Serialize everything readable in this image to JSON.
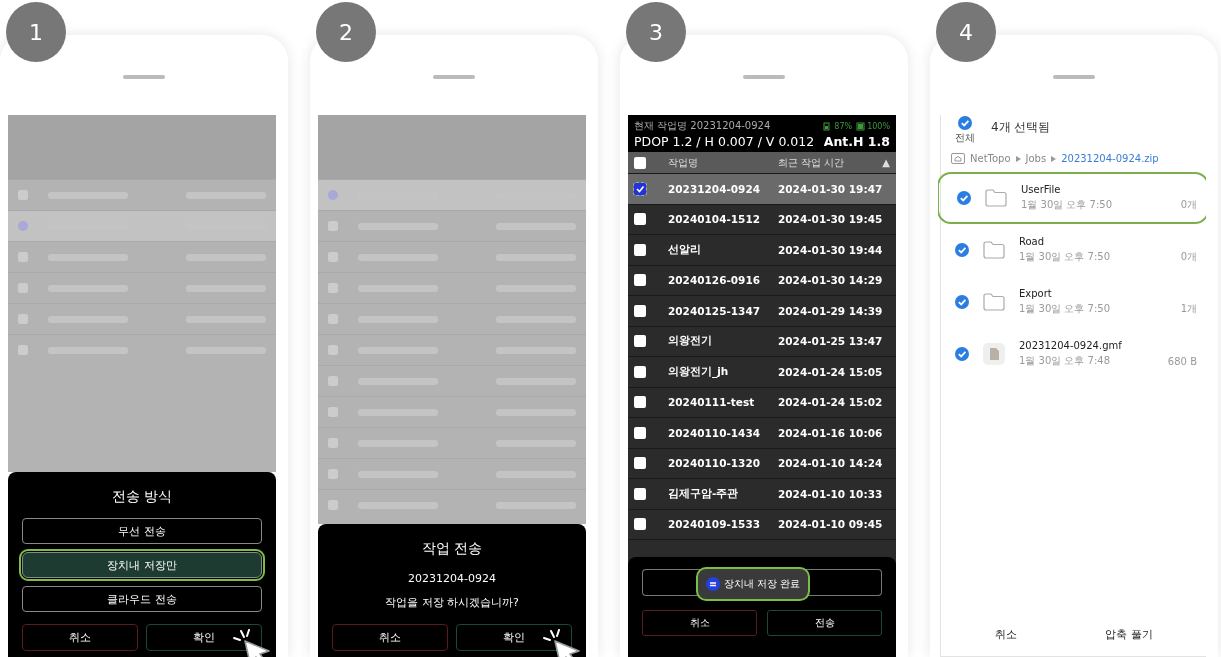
{
  "steps": [
    {
      "number": "1",
      "kind": "method",
      "dimmed_rows": [
        {
          "selected": false
        },
        {
          "selected": true
        },
        {
          "selected": false
        },
        {
          "selected": false
        },
        {
          "selected": false
        },
        {
          "selected": false
        }
      ],
      "dialog": {
        "title": "전송 방식",
        "options": [
          {
            "label": "무선 전송",
            "selected": false,
            "highlighted": false
          },
          {
            "label": "장치내 저장만",
            "selected": true,
            "highlighted": true
          },
          {
            "label": "클라우드 전송",
            "selected": false,
            "highlighted": false
          }
        ],
        "cancel": "취소",
        "confirm": "확인"
      }
    },
    {
      "number": "2",
      "kind": "confirm",
      "dimmed_rows": [
        {
          "selected": true
        },
        {
          "selected": false
        },
        {
          "selected": false
        },
        {
          "selected": false
        },
        {
          "selected": false
        },
        {
          "selected": false
        },
        {
          "selected": false
        },
        {
          "selected": false
        },
        {
          "selected": false
        },
        {
          "selected": false
        },
        {
          "selected": false
        }
      ],
      "dialog": {
        "title": "작업 전송",
        "job": "20231204-0924",
        "question": "작업을 저장 하시겠습니까?",
        "cancel": "취소",
        "confirm": "확인"
      }
    },
    {
      "number": "3",
      "kind": "jobs",
      "header": {
        "job_label": "현재 작업명 20231204-0924",
        "battery_1": "87%",
        "battery_2": "100%",
        "precision": "PDOP 1.2 / H 0.007 / V 0.012",
        "antenna": "Ant.H 1.8"
      },
      "select_all_checked": false,
      "columns": [
        "작업명",
        "최근 작업 시간",
        "▲"
      ],
      "rows": [
        {
          "name": "20231204-0924",
          "time": "2024-01-30 19:47",
          "checked": true
        },
        {
          "name": "20240104-1512",
          "time": "2024-01-30 19:45",
          "checked": false
        },
        {
          "name": "선알리",
          "time": "2024-01-30 19:44",
          "checked": false
        },
        {
          "name": "20240126-0916",
          "time": "2024-01-30 14:29",
          "checked": false
        },
        {
          "name": "20240125-1347",
          "time": "2024-01-29 14:39",
          "checked": false
        },
        {
          "name": "의왕전기",
          "time": "2024-01-25 13:47",
          "checked": false
        },
        {
          "name": "의왕전기_jh",
          "time": "2024-01-24 15:05",
          "checked": false
        },
        {
          "name": "20240111-test",
          "time": "2024-01-24 15:02",
          "checked": false
        },
        {
          "name": "20240110-1434",
          "time": "2024-01-16 10:06",
          "checked": false
        },
        {
          "name": "20240110-1320",
          "time": "2024-01-10 14:24",
          "checked": false
        },
        {
          "name": "김제구암-주관",
          "time": "2024-01-10 10:33",
          "checked": false
        },
        {
          "name": "20240109-1533",
          "time": "2024-01-10 09:45",
          "checked": false
        }
      ],
      "toast": {
        "text": "장치내 저장 완료",
        "highlighted": true
      },
      "cancel": "취소",
      "send": "전송"
    },
    {
      "number": "4",
      "kind": "files",
      "selected_count": "4개 선택됨",
      "select_all": "전체",
      "breadcrumb": [
        "NetTopo",
        "Jobs",
        "20231204-0924.zip"
      ],
      "files": [
        {
          "kind": "folder",
          "name": "UserFile",
          "date": "1월 30일 오후 7:50",
          "size": "0개",
          "checked": true,
          "highlighted": true
        },
        {
          "kind": "folder",
          "name": "Road",
          "date": "1월 30일 오후 7:50",
          "size": "0개",
          "checked": true,
          "highlighted": false
        },
        {
          "kind": "folder",
          "name": "Export",
          "date": "1월 30일 오후 7:50",
          "size": "1개",
          "checked": true,
          "highlighted": false
        },
        {
          "kind": "file",
          "name": "20231204-0924.gmf",
          "date": "1월 30일 오후 7:48",
          "size": "680 B",
          "checked": true,
          "highlighted": false
        }
      ],
      "cancel": "취소",
      "extract": "압축 풀기"
    }
  ]
}
